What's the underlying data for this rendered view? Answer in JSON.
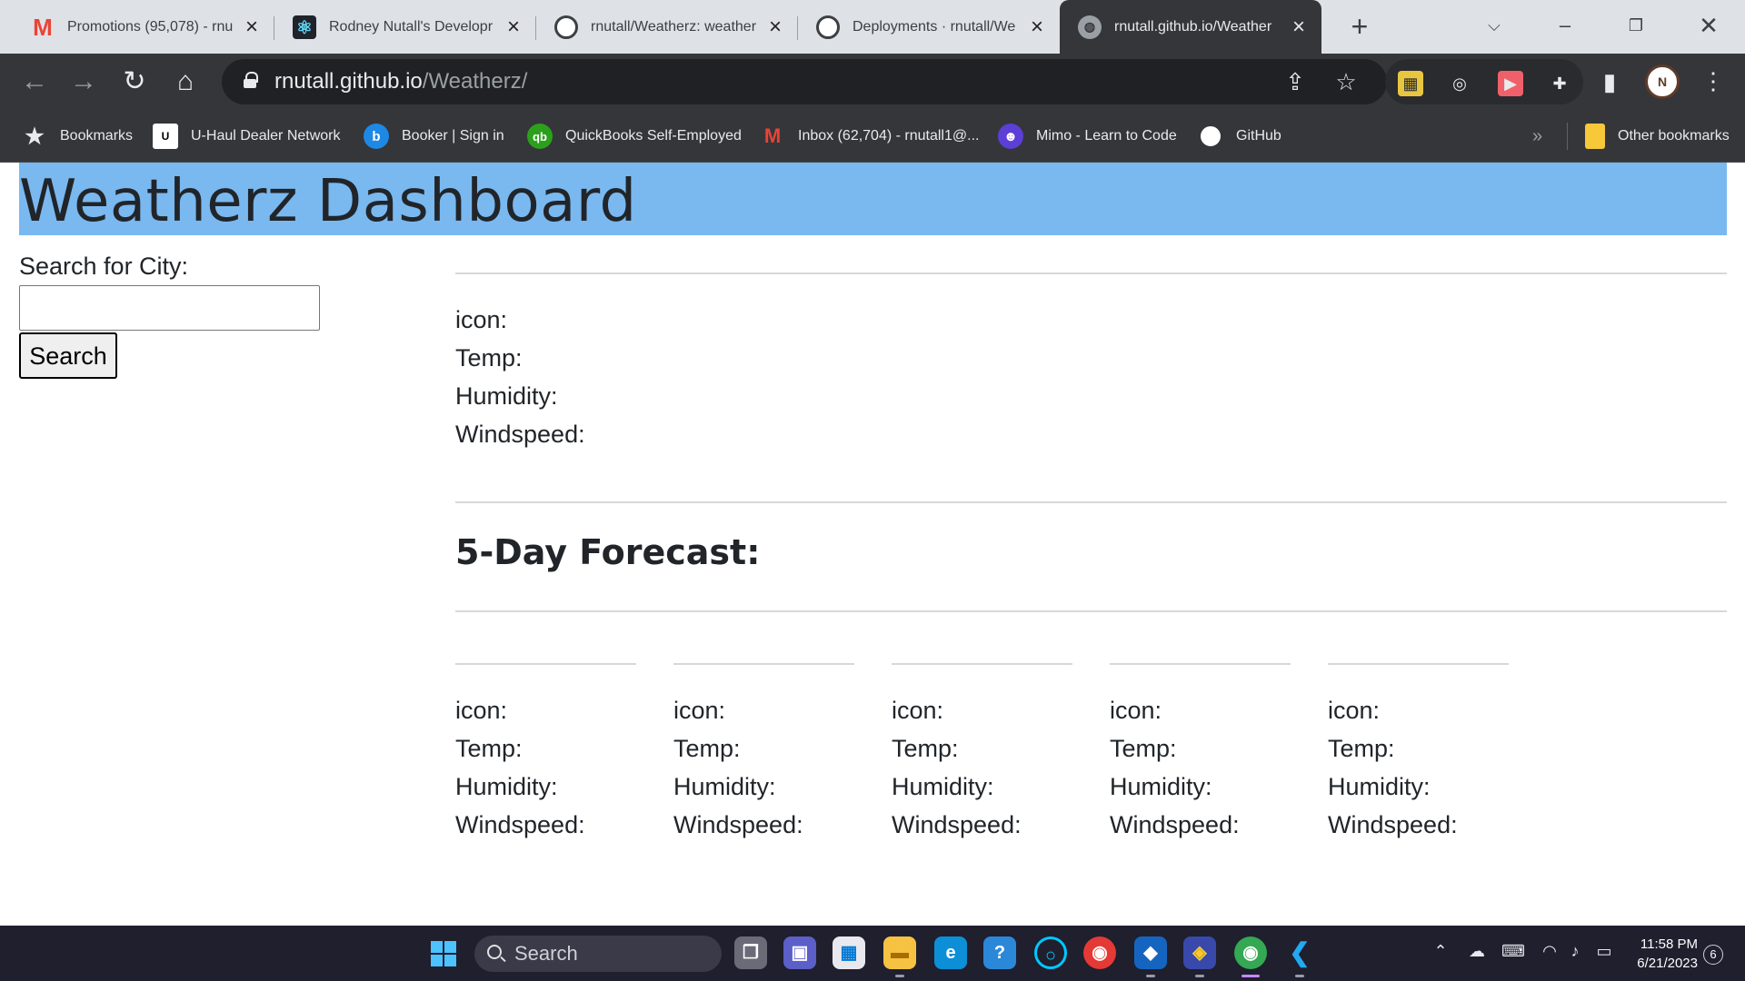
{
  "browser": {
    "tabs": [
      {
        "title": "Promotions (95,078) - rnu",
        "icon": "gmail-icon"
      },
      {
        "title": "Rodney Nutall's Developr",
        "icon": "react-icon"
      },
      {
        "title": "rnutall/Weatherz: weather",
        "icon": "github-icon"
      },
      {
        "title": "Deployments · rnutall/We",
        "icon": "github-icon"
      },
      {
        "title": "rnutall.github.io/Weather",
        "icon": "globe-icon",
        "active": true
      }
    ],
    "address": {
      "domain": "rnutall.github.io",
      "path": "/Weatherz/"
    },
    "bookmarks": [
      {
        "label": "Bookmarks",
        "icon": "star-icon"
      },
      {
        "label": "U-Haul Dealer Network",
        "icon": "uhaul-icon"
      },
      {
        "label": "Booker | Sign in",
        "icon": "booker-icon"
      },
      {
        "label": "QuickBooks Self-Employed",
        "icon": "quickbooks-icon"
      },
      {
        "label": "Inbox (62,704) - rnutall1@...",
        "icon": "gmail-icon"
      },
      {
        "label": "Mimo - Learn to Code",
        "icon": "mimo-icon"
      },
      {
        "label": "GitHub",
        "icon": "github-icon"
      }
    ],
    "other_bookmarks": "Other bookmarks",
    "profile_initial": "N"
  },
  "page": {
    "title": "Weatherz Dashboard",
    "search_label": "Search for City:",
    "search_value": "",
    "search_button": "Search",
    "current": {
      "icon_label": "icon:",
      "temp_label": "Temp:",
      "humidity_label": "Humidity:",
      "windspeed_label": "Windspeed:"
    },
    "forecast_title": "5-Day Forecast:",
    "forecast_days": [
      {
        "icon_label": "icon:",
        "temp_label": "Temp:",
        "humidity_label": "Humidity:",
        "windspeed_label": "Windspeed:"
      },
      {
        "icon_label": "icon:",
        "temp_label": "Temp:",
        "humidity_label": "Humidity:",
        "windspeed_label": "Windspeed:"
      },
      {
        "icon_label": "icon:",
        "temp_label": "Temp:",
        "humidity_label": "Humidity:",
        "windspeed_label": "Windspeed:"
      },
      {
        "icon_label": "icon:",
        "temp_label": "Temp:",
        "humidity_label": "Humidity:",
        "windspeed_label": "Windspeed:"
      },
      {
        "icon_label": "icon:",
        "temp_label": "Temp:",
        "humidity_label": "Humidity:",
        "windspeed_label": "Windspeed:"
      }
    ]
  },
  "taskbar": {
    "search_label": "Search",
    "time": "11:58 PM",
    "date": "6/21/2023",
    "notification_count": "6"
  },
  "colors": {
    "header_background": "#7ab8f0",
    "chrome_dark": "#35363a",
    "taskbar": "#1f1f2e"
  }
}
